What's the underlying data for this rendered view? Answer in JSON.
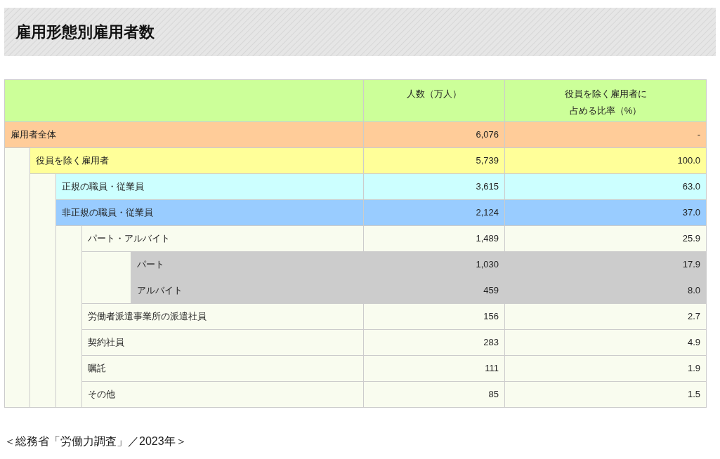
{
  "title": "雇用形態別雇用者数",
  "table": {
    "columns": [
      "人数（万人）",
      "役員を除く雇用者に占める比率（%）"
    ],
    "rows": [
      {
        "label": "雇用者全体",
        "count": "6,076",
        "ratio": "-",
        "color": "#ffcc99",
        "children": [
          {
            "label": "役員を除く雇用者",
            "count": "5,739",
            "ratio": "100.0",
            "color": "#ffff99",
            "children": [
              {
                "label": "正規の職員・従業員",
                "count": "3,615",
                "ratio": "63.0",
                "color": "#ccffff"
              },
              {
                "label": "非正規の職員・従業員",
                "count": "2,124",
                "ratio": "37.0",
                "color": "#99ccff",
                "children": [
                  {
                    "label": "パート・アルバイト",
                    "count": "1,489",
                    "ratio": "25.9",
                    "color": "#f9fcef",
                    "children": [
                      {
                        "label": "パート",
                        "count": "1,030",
                        "ratio": "17.9",
                        "color": "#cccccc"
                      },
                      {
                        "label": "アルバイト",
                        "count": "459",
                        "ratio": "8.0",
                        "color": "#cccccc"
                      }
                    ]
                  },
                  {
                    "label": "労働者派遣事業所の派遣社員",
                    "count": "156",
                    "ratio": "2.7",
                    "color": "#f9fcef"
                  },
                  {
                    "label": "契約社員",
                    "count": "283",
                    "ratio": "4.9",
                    "color": "#f9fcef"
                  },
                  {
                    "label": "嘱託",
                    "count": "111",
                    "ratio": "1.9",
                    "color": "#f9fcef"
                  },
                  {
                    "label": "その他",
                    "count": "85",
                    "ratio": "1.5",
                    "color": "#f9fcef"
                  }
                ]
              }
            ]
          }
        ]
      }
    ]
  },
  "source": "＜総務省「労働力調査」／2023年＞"
}
